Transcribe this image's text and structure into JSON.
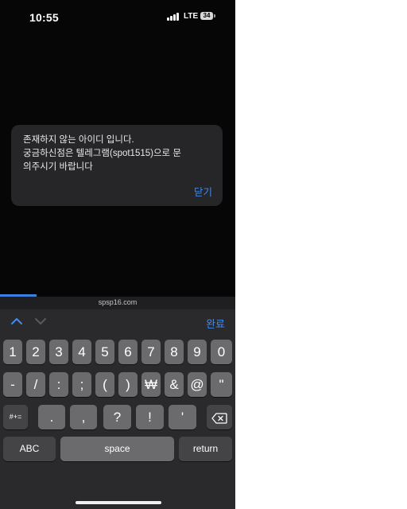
{
  "status_bar": {
    "time": "10:55",
    "network": "LTE",
    "battery": "34"
  },
  "alert": {
    "line1": "존재하지 않는 아이디 입니다.",
    "line2": "궁금하신점은 텔레그램(spot1515)으로 문",
    "line3": "의주시기 바랍니다",
    "button": "닫기"
  },
  "browser": {
    "url": "spsp16.com"
  },
  "keyboard": {
    "toolbar": {
      "up_icon": "chevron-up-icon",
      "down_icon": "chevron-down-icon",
      "done_label": "완료"
    },
    "row1": [
      "1",
      "2",
      "3",
      "4",
      "5",
      "6",
      "7",
      "8",
      "9",
      "0"
    ],
    "row2": [
      "-",
      "/",
      ":",
      ";",
      "(",
      ")",
      "₩",
      "&",
      "@",
      "\""
    ],
    "row3": {
      "symbols_label": "#+=",
      "keys": [
        ".",
        ",",
        "?",
        "!",
        "'"
      ],
      "delete_icon": "backspace-icon"
    },
    "row4": {
      "abc_label": "ABC",
      "space_label": "space",
      "return_label": "return"
    }
  },
  "colors": {
    "accent": "#3e8cf2",
    "alert_bg": "#262628",
    "keyboard_bg": "#2a2a2c",
    "key_bg": "#6b6b6e"
  }
}
